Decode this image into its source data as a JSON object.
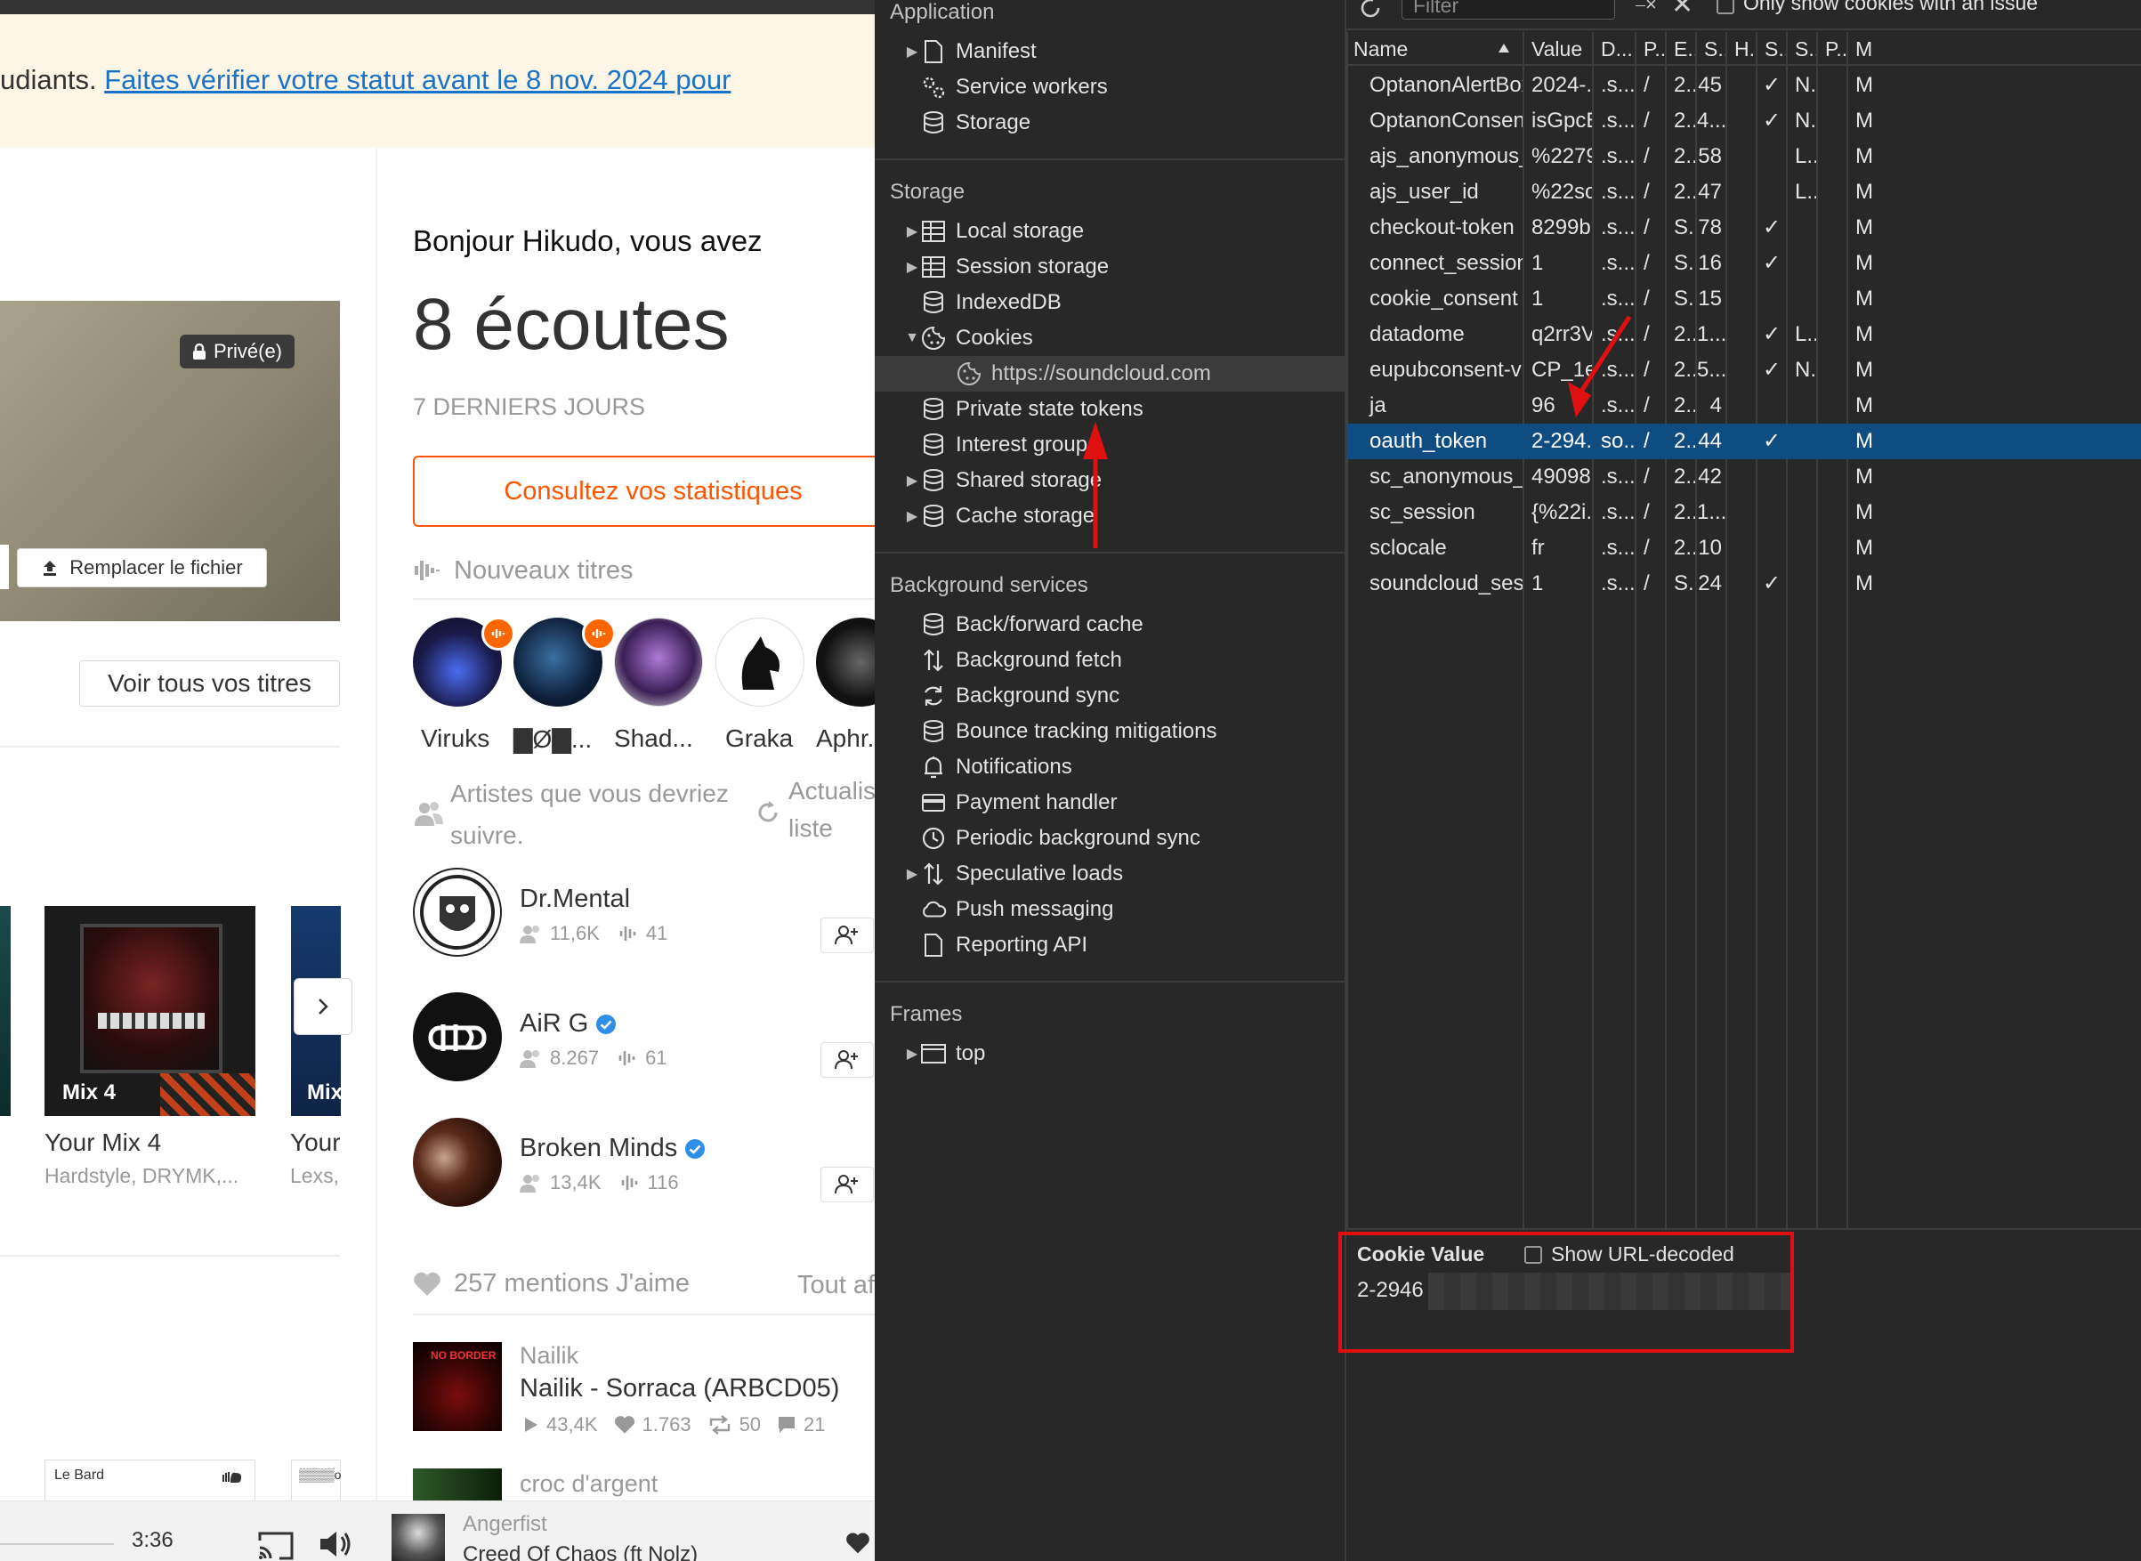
{
  "soundcloud": {
    "banner": {
      "text_prefix": "udiants. ",
      "link": "Faites vérifier votre statut avant le 8 nov. 2024 pour"
    },
    "upload": {
      "private_badge": "Privé(e)",
      "replace_file": "Remplacer le fichier",
      "view_all_tracks": "Voir tous vos titres"
    },
    "mixes": [
      {
        "badge": "Mix 4",
        "title": "Your Mix 4",
        "subtitle": "Hardstyle, DRYMK,..."
      },
      {
        "badge": "Mix",
        "title": "Your",
        "subtitle": "Lexs,"
      }
    ],
    "bottom_cards": {
      "card1_label": "Le Bard",
      "card2_label": "▒▒▒▒o"
    },
    "greeting": "Bonjour Hikudo, vous avez",
    "plays": "8 écoutes",
    "period": "7 DERNIERS JOURS",
    "stats_button": "Consultez vos statistiques",
    "new_tracks_heading": "Nouveaux titres",
    "new_track_artists": [
      "Viruks",
      "▇Ø▇...",
      "Shad...",
      "Graka",
      "Aphr..."
    ],
    "suggest_heading": "Artistes que vous devriez suivre.",
    "refresh_label": "Actualiser la liste",
    "refresh_line1": "Actualis",
    "refresh_line2": "liste",
    "suggested": [
      {
        "name": "Dr.Mental",
        "followers": "11,6K",
        "tracks": "41",
        "verified": false
      },
      {
        "name": "AiR G",
        "followers": "8.267",
        "tracks": "61",
        "verified": true
      },
      {
        "name": "Broken Minds",
        "followers": "13,4K",
        "tracks": "116",
        "verified": true
      }
    ],
    "likes_heading": "257 mentions J'aime",
    "likes_view_all": "Tout af",
    "liked": [
      {
        "artist": "Nailik",
        "title": "Nailik - Sorraca (ARBCD05)",
        "plays": "43,4K",
        "likes": "1.763",
        "reposts": "50",
        "comments": "21",
        "cover_text": "NO BORDER"
      },
      {
        "artist": "croc d'argent"
      }
    ],
    "player": {
      "time": "3:36",
      "artist": "Angerfist",
      "track": "Creed Of Chaos (ft Nolz)"
    }
  },
  "devtools": {
    "sidebar": {
      "application_header": "Application",
      "application_items": [
        "Manifest",
        "Service workers",
        "Storage"
      ],
      "storage_header": "Storage",
      "storage_items": [
        "Local storage",
        "Session storage",
        "IndexedDB",
        "Cookies",
        "https://soundcloud.com",
        "Private state tokens",
        "Interest groups",
        "Shared storage",
        "Cache storage"
      ],
      "background_header": "Background services",
      "background_items": [
        "Back/forward cache",
        "Background fetch",
        "Background sync",
        "Bounce tracking mitigations",
        "Notifications",
        "Payment handler",
        "Periodic background sync",
        "Speculative loads",
        "Push messaging",
        "Reporting API"
      ],
      "frames_header": "Frames",
      "frames_items": [
        "top"
      ]
    },
    "toolbar": {
      "filter_placeholder": "Filter",
      "only_issue_label": "Only show cookies with an issue"
    },
    "columns": [
      "Name",
      "Value",
      "D...",
      "P...",
      "E...",
      "S...",
      "H...",
      "S...",
      "S...",
      "P...",
      "M"
    ],
    "cookies": [
      {
        "name": "OptanonAlertBoxClo...",
        "value": "2024-...",
        "domain": ".s...",
        "path": "/",
        "expires": "2...",
        "size": "45",
        "http": "",
        "secure": "✓",
        "samesite": "N...",
        "priority": "",
        "more": "M"
      },
      {
        "name": "OptanonConsent",
        "value": "isGpcE...",
        "domain": ".s...",
        "path": "/",
        "expires": "2...",
        "size": "4...",
        "http": "",
        "secure": "✓",
        "samesite": "N...",
        "priority": "",
        "more": "M"
      },
      {
        "name": "ajs_anonymous_id",
        "value": "%2279...",
        "domain": ".s...",
        "path": "/",
        "expires": "2...",
        "size": "58",
        "http": "",
        "secure": "",
        "samesite": "L...",
        "priority": "",
        "more": "M"
      },
      {
        "name": "ajs_user_id",
        "value": "%22so...",
        "domain": ".s...",
        "path": "/",
        "expires": "2...",
        "size": "47",
        "http": "",
        "secure": "",
        "samesite": "L...",
        "priority": "",
        "more": "M"
      },
      {
        "name": "checkout-token",
        "value": "8299b...",
        "domain": ".s...",
        "path": "/",
        "expires": "S...",
        "size": "78",
        "http": "",
        "secure": "✓",
        "samesite": "",
        "priority": "",
        "more": "M"
      },
      {
        "name": "connect_session",
        "value": "1",
        "domain": ".s...",
        "path": "/",
        "expires": "S...",
        "size": "16",
        "http": "",
        "secure": "✓",
        "samesite": "",
        "priority": "",
        "more": "M"
      },
      {
        "name": "cookie_consent",
        "value": "1",
        "domain": ".s...",
        "path": "/",
        "expires": "S...",
        "size": "15",
        "http": "",
        "secure": "",
        "samesite": "",
        "priority": "",
        "more": "M"
      },
      {
        "name": "datadome",
        "value": "q2rr3V...",
        "domain": ".s...",
        "path": "/",
        "expires": "2...",
        "size": "1...",
        "http": "",
        "secure": "✓",
        "samesite": "L...",
        "priority": "",
        "more": "M"
      },
      {
        "name": "eupubconsent-v2",
        "value": "CP_1e...",
        "domain": ".s...",
        "path": "/",
        "expires": "2...",
        "size": "5...",
        "http": "",
        "secure": "✓",
        "samesite": "N...",
        "priority": "",
        "more": "M"
      },
      {
        "name": "ja",
        "value": "96",
        "domain": ".s...",
        "path": "/",
        "expires": "2...",
        "size": "4",
        "http": "",
        "secure": "",
        "samesite": "",
        "priority": "",
        "more": "M"
      },
      {
        "name": "oauth_token",
        "value": "2-294...",
        "domain": "so...",
        "path": "/",
        "expires": "2...",
        "size": "44",
        "http": "",
        "secure": "✓",
        "samesite": "",
        "priority": "",
        "more": "M",
        "selected": true
      },
      {
        "name": "sc_anonymous_id",
        "value": "49098...",
        "domain": ".s...",
        "path": "/",
        "expires": "2...",
        "size": "42",
        "http": "",
        "secure": "",
        "samesite": "",
        "priority": "",
        "more": "M"
      },
      {
        "name": "sc_session",
        "value": "{%22i...",
        "domain": ".s...",
        "path": "/",
        "expires": "2...",
        "size": "1...",
        "http": "",
        "secure": "",
        "samesite": "",
        "priority": "",
        "more": "M"
      },
      {
        "name": "sclocale",
        "value": "fr",
        "domain": ".s...",
        "path": "/",
        "expires": "2...",
        "size": "10",
        "http": "",
        "secure": "",
        "samesite": "",
        "priority": "",
        "more": "M"
      },
      {
        "name": "soundcloud_session...",
        "value": "1",
        "domain": ".s...",
        "path": "/",
        "expires": "S...",
        "size": "24",
        "http": "",
        "secure": "✓",
        "samesite": "",
        "priority": "",
        "more": "M"
      }
    ],
    "cookie_value": {
      "title": "Cookie Value",
      "show_decoded": "Show URL-decoded",
      "value": "2-2946"
    }
  },
  "colors": {
    "accent": "#ff5500",
    "link": "#1a73c8",
    "selection": "#0f4c81",
    "annotation": "#e01010",
    "verified": "#2f8fe8"
  },
  "icons": [
    "lock-icon",
    "upload-icon",
    "waveform-icon",
    "users-icon",
    "refresh-icon",
    "heart-icon",
    "play-icon",
    "repost-icon",
    "comment-icon",
    "cast-icon",
    "volume-icon",
    "file-icon",
    "gears-icon",
    "database-icon",
    "table-icon",
    "cookie-icon",
    "arrows-icon",
    "sync-icon",
    "bell-icon",
    "card-icon",
    "clock-icon",
    "cloud-icon",
    "frame-icon",
    "reload-icon",
    "clear-icon",
    "close-icon",
    "sort-up-icon",
    "checkbox-icon"
  ]
}
